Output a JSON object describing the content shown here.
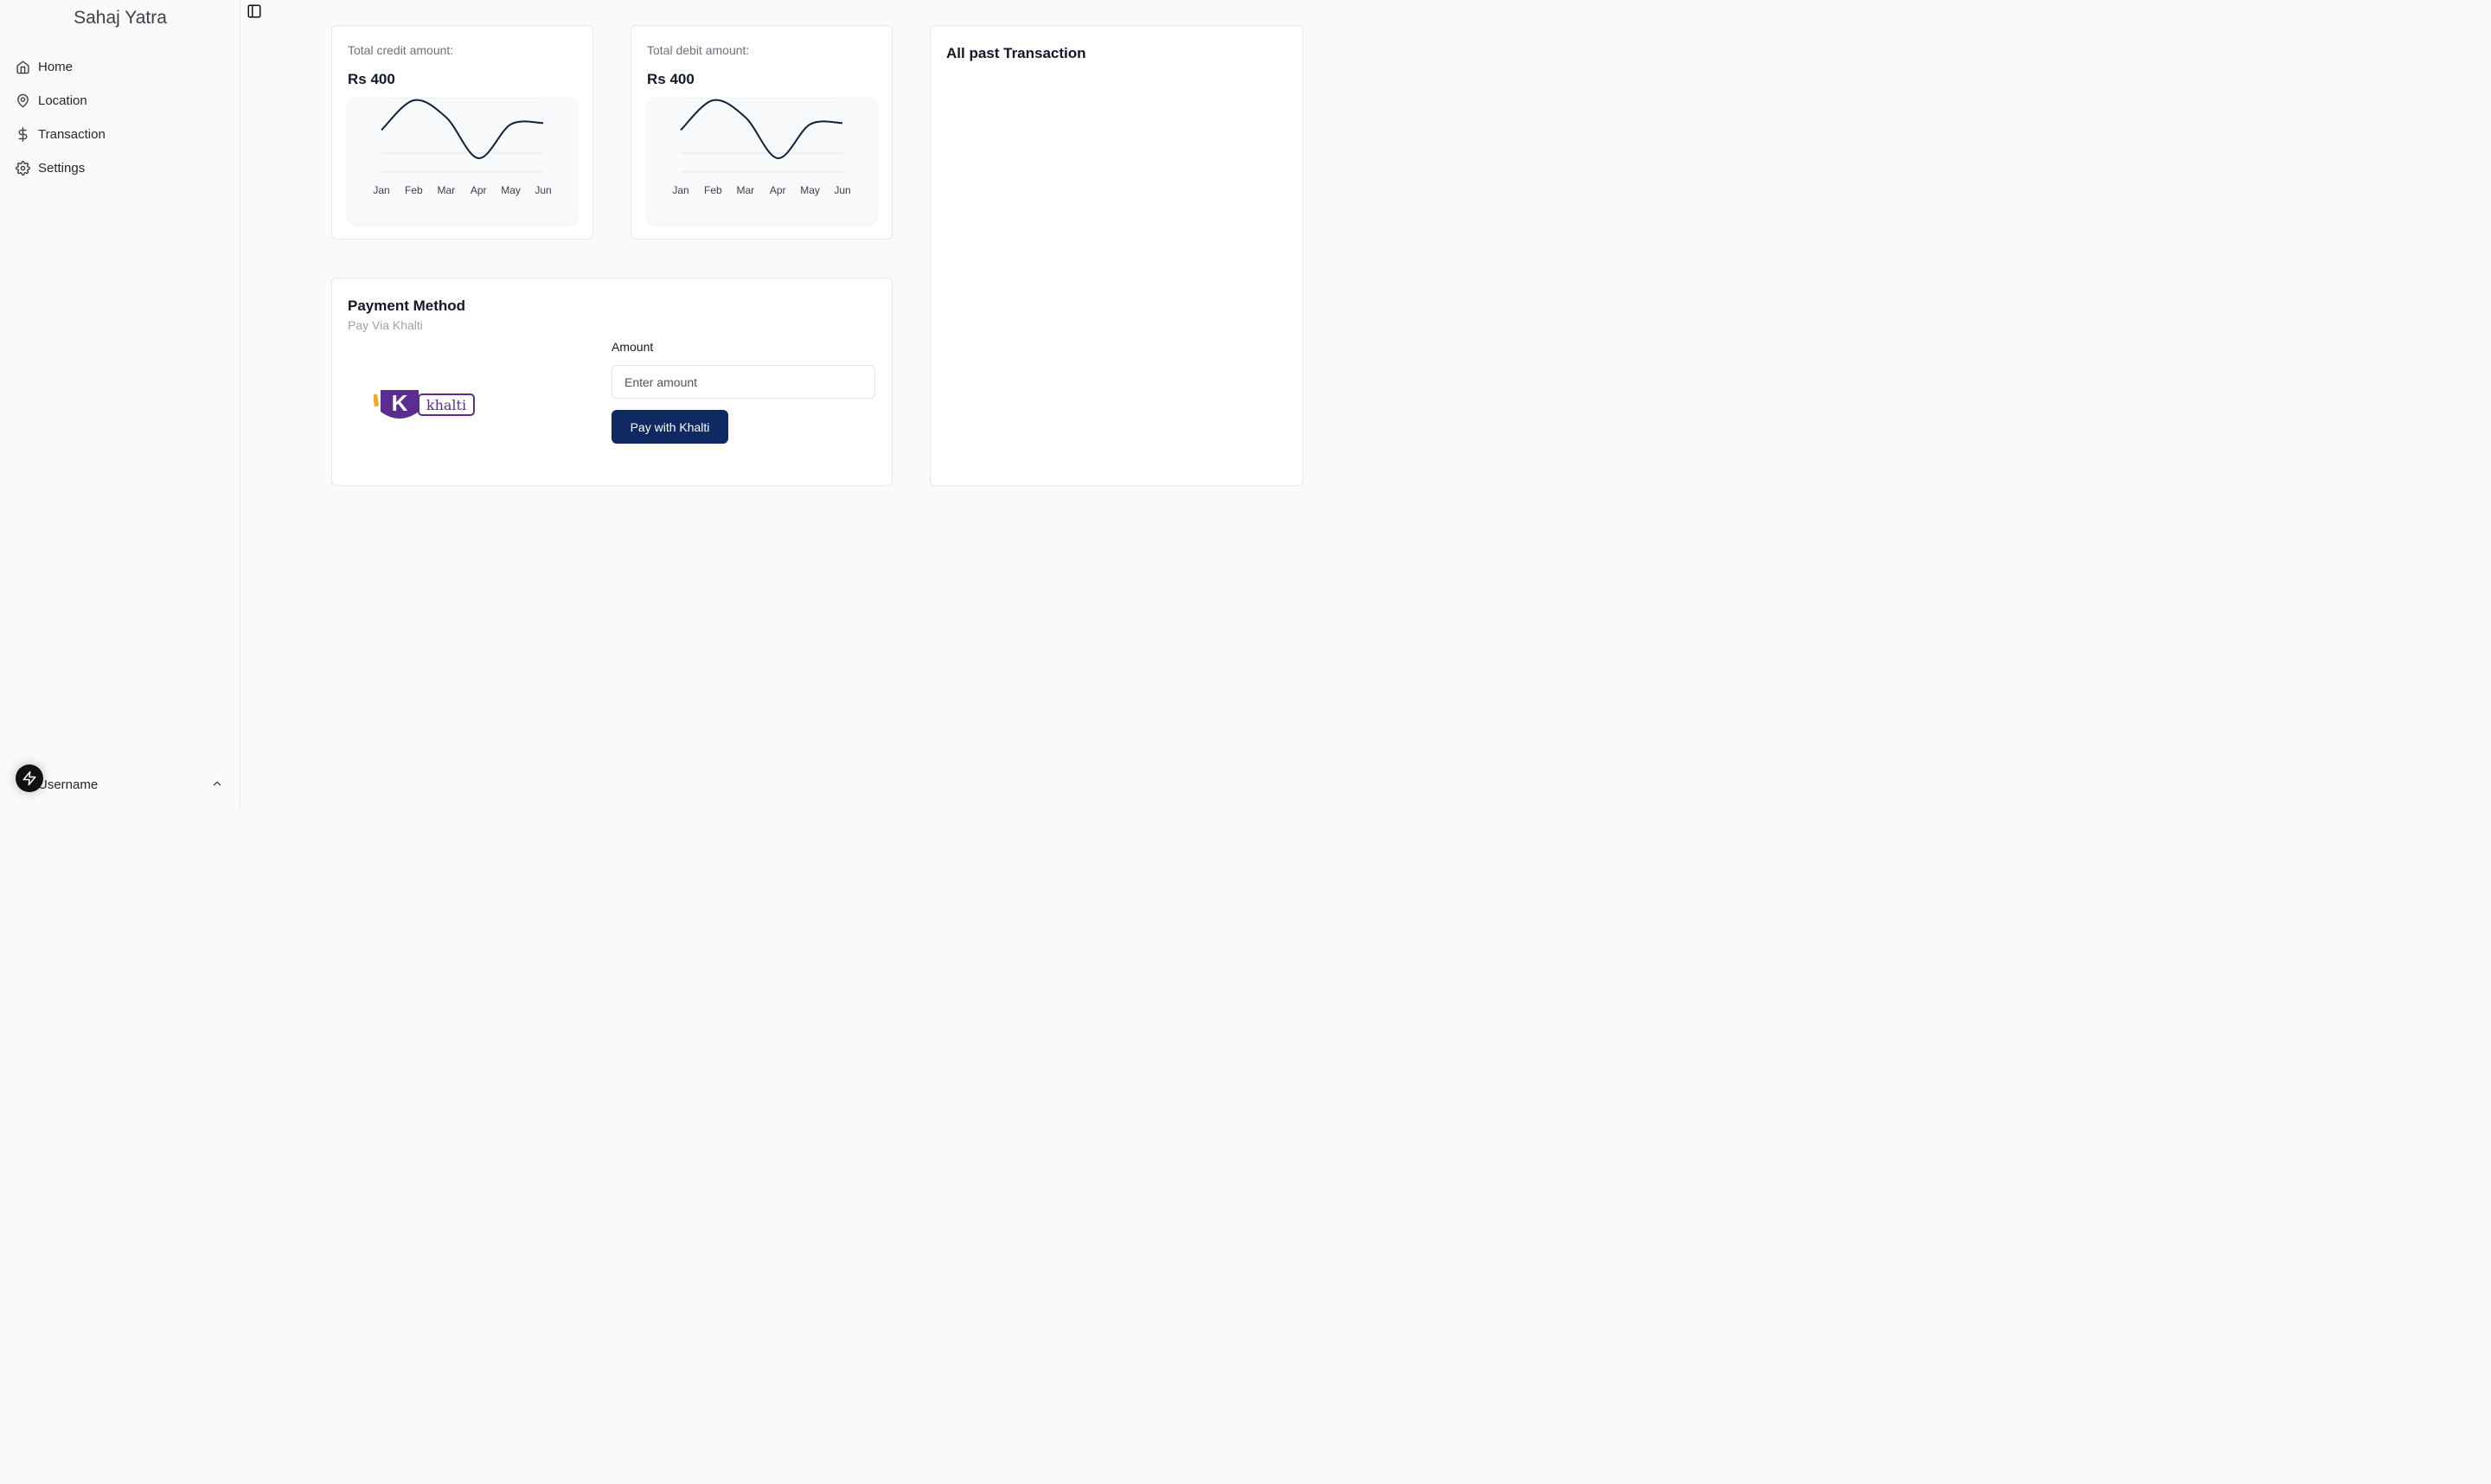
{
  "app": {
    "title": "Sahaj Yatra"
  },
  "sidebar": {
    "items": [
      {
        "label": "Home",
        "icon": "home-icon"
      },
      {
        "label": "Location",
        "icon": "map-pin-icon"
      },
      {
        "label": "Transaction",
        "icon": "dollar-icon"
      },
      {
        "label": "Settings",
        "icon": "gear-icon"
      }
    ],
    "user": {
      "label": "Username",
      "icon": "chevron-up-icon"
    }
  },
  "credit": {
    "label": "Total credit amount:",
    "value": "Rs 400"
  },
  "debit": {
    "label": "Total debit amount:",
    "value": "Rs 400"
  },
  "transactions": {
    "title": "All past Transaction"
  },
  "payment": {
    "title": "Payment Method",
    "subtitle": "Pay Via Khalti",
    "logo_text": "khalti",
    "amount_label": "Amount",
    "amount_placeholder": "Enter amount",
    "amount_value": "",
    "pay_button": "Pay with Khalti"
  },
  "colors": {
    "accent": "#0f2a63",
    "khalti_purple": "#5c2d91",
    "khalti_orange": "#f6a623",
    "line": "#0f1f3d"
  },
  "chart_data": [
    {
      "type": "line",
      "categories": [
        "Jan",
        "Feb",
        "Mar",
        "Apr",
        "May",
        "Jun"
      ],
      "series": [
        {
          "values": [
            186,
            305,
            237,
            73,
            209,
            214
          ]
        }
      ],
      "title": "",
      "xlabel": "",
      "ylabel": "",
      "grid": true
    },
    {
      "type": "line",
      "categories": [
        "Jan",
        "Feb",
        "Mar",
        "Apr",
        "May",
        "Jun"
      ],
      "series": [
        {
          "values": [
            186,
            305,
            237,
            73,
            209,
            214
          ]
        }
      ],
      "title": "",
      "xlabel": "",
      "ylabel": "",
      "grid": true
    }
  ]
}
